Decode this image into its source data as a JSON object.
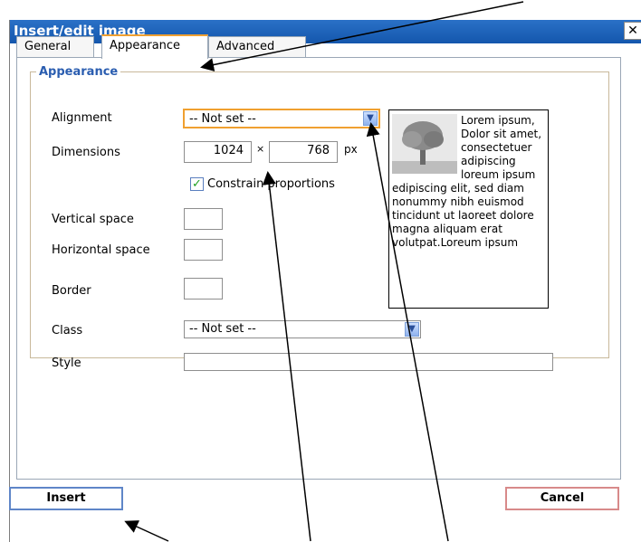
{
  "dialog": {
    "title": "Insert/edit image",
    "close_glyph": "✕"
  },
  "tabs": [
    {
      "label": "General",
      "active": false
    },
    {
      "label": "Appearance",
      "active": true
    },
    {
      "label": "Advanced",
      "active": false
    }
  ],
  "appearance": {
    "legend": "Appearance",
    "alignment_label": "Alignment",
    "alignment_value": "-- Not set --",
    "dimensions_label": "Dimensions",
    "width": "1024",
    "times": "×",
    "height": "768",
    "unit": "px",
    "constrain_label": "Constrain proportions",
    "constrain_checked": true,
    "vspace_label": "Vertical space",
    "vspace_value": "",
    "hspace_label": "Horizontal space",
    "hspace_value": "",
    "border_label": "Border",
    "border_value": "",
    "class_label": "Class",
    "class_value": "-- Not set --",
    "style_label": "Style",
    "style_value": ""
  },
  "preview": {
    "text": "Lorem ipsum, Dolor sit amet, consectetuer adipiscing loreum ipsum edipiscing elit, sed diam nonummy nibh euismod tincidunt ut laoreet dolore magna aliquam erat volutpat.Loreum ipsum"
  },
  "buttons": {
    "insert": "Insert",
    "cancel": "Cancel"
  }
}
